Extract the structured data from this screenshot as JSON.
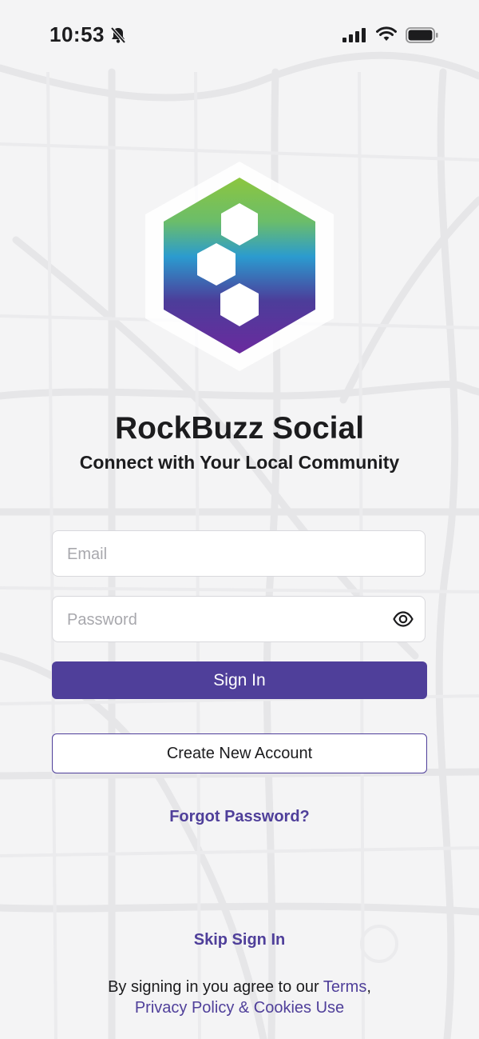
{
  "status_bar": {
    "time": "10:53",
    "icons": [
      "bell-slash-icon",
      "cellular-signal-icon",
      "wifi-icon",
      "battery-icon"
    ]
  },
  "brand": {
    "logo_icon": "hexagon-logo-icon",
    "title": "RockBuzz Social",
    "subtitle": "Connect with Your Local Community",
    "gradient_colors": [
      "#8cc63f",
      "#2b9bcf",
      "#4c3d9a",
      "#6a2a9e"
    ]
  },
  "form": {
    "email_placeholder": "Email",
    "password_placeholder": "Password",
    "show_password_icon": "eye-icon",
    "sign_in_label": "Sign In",
    "create_account_label": "Create New Account",
    "forgot_password_label": "Forgot Password?"
  },
  "skip_label": "Skip Sign In",
  "legal": {
    "prefix": "By signing in you agree to our ",
    "terms_label": "Terms",
    "separator": ",",
    "privacy_label": "Privacy Policy & Cookies Use"
  },
  "colors": {
    "accent": "#4f3f9a",
    "background": "#f4f4f5",
    "text": "#1c1c1e",
    "placeholder": "#a8a8ad"
  }
}
